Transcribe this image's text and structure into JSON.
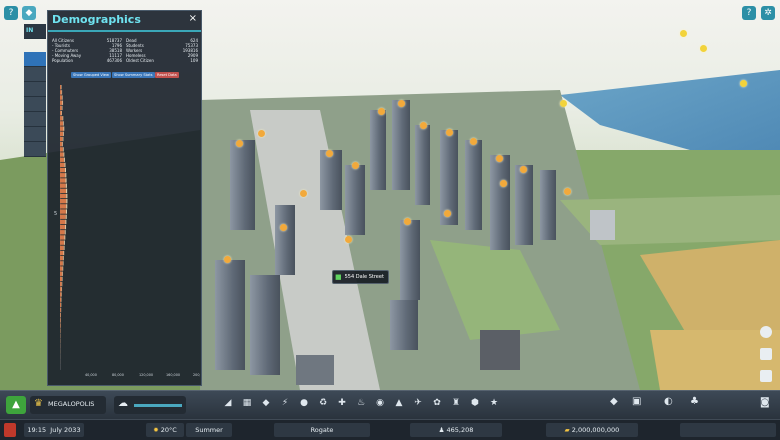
{
  "panel": {
    "title": "Demographics",
    "tab_label": "IN",
    "close_glyph": "×",
    "stats_left": [
      {
        "label": "All Citizens",
        "value": "518737"
      },
      {
        "label": "- Tourists",
        "value": "1796"
      },
      {
        "label": "- Commuters",
        "value": "38518"
      },
      {
        "label": "- Moving Away",
        "value": "11117"
      },
      {
        "label": "Population",
        "value": "467306"
      }
    ],
    "stats_right": [
      {
        "label": "Dead",
        "value": "624"
      },
      {
        "label": "Students",
        "value": "75373"
      },
      {
        "label": "Workers",
        "value": "193816"
      },
      {
        "label": "Homeless",
        "value": "2909"
      },
      {
        "label": "Oldest Citizen",
        "value": "109"
      }
    ],
    "buttons": [
      "Show Grouped View",
      "Show Summary Stats",
      "Reset Data"
    ],
    "button_colors": [
      "#3a76b8",
      "#3a76b8",
      "#c0504d"
    ],
    "axis_ticks": [
      "0",
      "40,000",
      "80,000",
      "120,000",
      "160,000",
      "200,000"
    ],
    "side_label": "5"
  },
  "chart_data": {
    "type": "bar",
    "orientation": "horizontal",
    "title": "",
    "x_ticks": [
      "0",
      "40,000",
      "80,000",
      "120,000",
      "160,000",
      "200,000"
    ],
    "xlim": [
      0,
      200000
    ],
    "series": [
      {
        "color": "#d4784a",
        "values": [
          1800,
          2400,
          3000,
          3600,
          2800,
          2200,
          3900,
          4600,
          5200,
          4800,
          4100,
          3500,
          4400,
          5300,
          6000,
          6800,
          7400,
          7900,
          8200,
          8600,
          9000,
          9300,
          9400,
          9200,
          8800,
          8500,
          8000,
          7600,
          7100,
          6600,
          6100,
          5600,
          5200,
          4700,
          4300,
          3900,
          3500,
          3100,
          2700,
          2400,
          2100,
          1800,
          1500,
          1300,
          1100,
          900,
          750,
          600,
          450,
          350,
          250,
          180,
          120,
          80,
          50
        ]
      },
      {
        "color": "#e7d7b4",
        "values": [
          600,
          700,
          800,
          900,
          800,
          700,
          900,
          1000,
          1100,
          1000,
          900,
          800,
          1000,
          1100,
          1200,
          1300,
          1400,
          1450,
          1500,
          1550,
          1600,
          1600,
          1580,
          1550,
          1500,
          1450,
          1400,
          1350,
          1300,
          1250,
          1200,
          1100,
          1000,
          950,
          900,
          850,
          800,
          700,
          650,
          600,
          550,
          500,
          450,
          400,
          350,
          300,
          260,
          220,
          180,
          140,
          110,
          80,
          60,
          40,
          20
        ]
      }
    ]
  },
  "scene": {
    "tooltip_street": "554 Dale Street",
    "tooltip_icon": "home-icon"
  },
  "toolbar": {
    "city_name": "MEGALOPOLIS",
    "tools": [
      "roads-icon",
      "zoning-icon",
      "districts-icon",
      "electricity-icon",
      "water-icon",
      "garbage-icon",
      "healthcare-icon",
      "fire-icon",
      "police-icon",
      "education-icon",
      "transport-icon",
      "beautification-icon",
      "monuments-icon",
      "landscaping-icon",
      "unique-icon"
    ]
  },
  "status": {
    "time": "19:15",
    "date": "July 2033",
    "temperature": "20°C",
    "season": "Summer",
    "radio_station": "Rogate",
    "population": "465,208",
    "money": "2,000,000,000"
  },
  "colors": {
    "panel_title": "#6fe3f0",
    "accent": "#2c8fa6",
    "toolbar_green": "#3ea43c",
    "bar_main": "#d4784a",
    "bar_light": "#e7d7b4"
  }
}
